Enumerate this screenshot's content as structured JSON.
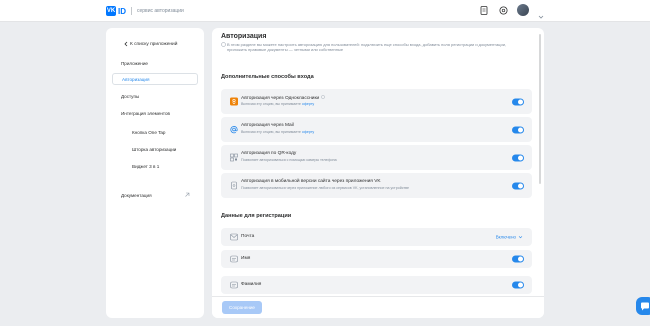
{
  "header": {
    "logo_text": "ID",
    "service_label": "сервис авторизации"
  },
  "sidebar": {
    "back_label": "К списку приложений",
    "items": [
      {
        "label": "Приложение"
      },
      {
        "label": "Авторизация"
      },
      {
        "label": "Доступы"
      },
      {
        "label": "Интеграция элементов"
      },
      {
        "label": "Кнопка One Tap"
      },
      {
        "label": "Шторка авторизации"
      },
      {
        "label": "Виджет 3 в 1"
      },
      {
        "label": "Документация"
      }
    ]
  },
  "main": {
    "title": "Авторизация",
    "description": "В этом разделе вы можете настроить авторизацию для пользователей: подключить еще способы входа, добавить поля регистрации и документации, приложить правовые документы — четными или собственные",
    "sections": {
      "extra_login_title": "Дополнительные способы входа",
      "registration_title": "Данные для регистрации"
    },
    "login_methods": [
      {
        "title": "Авторизация через Одноклассники",
        "desc_prefix": "Включая эту опцию, вы принимаете ",
        "desc_link": "оферту",
        "enabled": true
      },
      {
        "title": "Авторизация через Mail",
        "desc_prefix": "Включая эту опцию, вы принимаете ",
        "desc_link": "оферту",
        "enabled": true
      },
      {
        "title": "Авторизация по QR-коду",
        "desc_prefix": "Позволяет авторизоваться с помощью камеры телефона",
        "desc_link": "",
        "enabled": true
      },
      {
        "title": "Авторизация в мобильной версии сайта через приложения VK",
        "desc_prefix": "Позволяет авторизоваться через приложение любого из сервисов VK, установленное на устройстве",
        "desc_link": "",
        "enabled": true
      }
    ],
    "registration_fields": [
      {
        "label": "Почта",
        "value": "Включено"
      },
      {
        "label": "Имя",
        "enabled": true
      },
      {
        "label": "Фамилия",
        "enabled": true
      }
    ],
    "save_label": "Сохранение"
  },
  "colors": {
    "accent": "#2688eb",
    "ok_orange": "#ee8208",
    "background": "#ebedf0"
  }
}
